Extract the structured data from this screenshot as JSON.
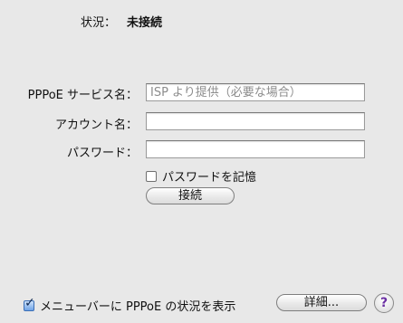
{
  "status": {
    "label": "状況：",
    "value": "未接続"
  },
  "pppoe_service": {
    "label": "PPPoE サービス名：",
    "placeholder": "ISP より提供（必要な場合）",
    "value": ""
  },
  "account": {
    "label": "アカウント名：",
    "value": ""
  },
  "password": {
    "label": "パスワード：",
    "value": ""
  },
  "remember_password": {
    "label": "パスワードを記憶",
    "checked": false
  },
  "connect_button": {
    "label": "接続"
  },
  "menubar_status": {
    "label": "メニューバーに PPPoE の状況を表示",
    "checked": true
  },
  "details_button": {
    "label": "詳細..."
  },
  "help_button": {
    "glyph": "?",
    "icon": "help-icon"
  }
}
